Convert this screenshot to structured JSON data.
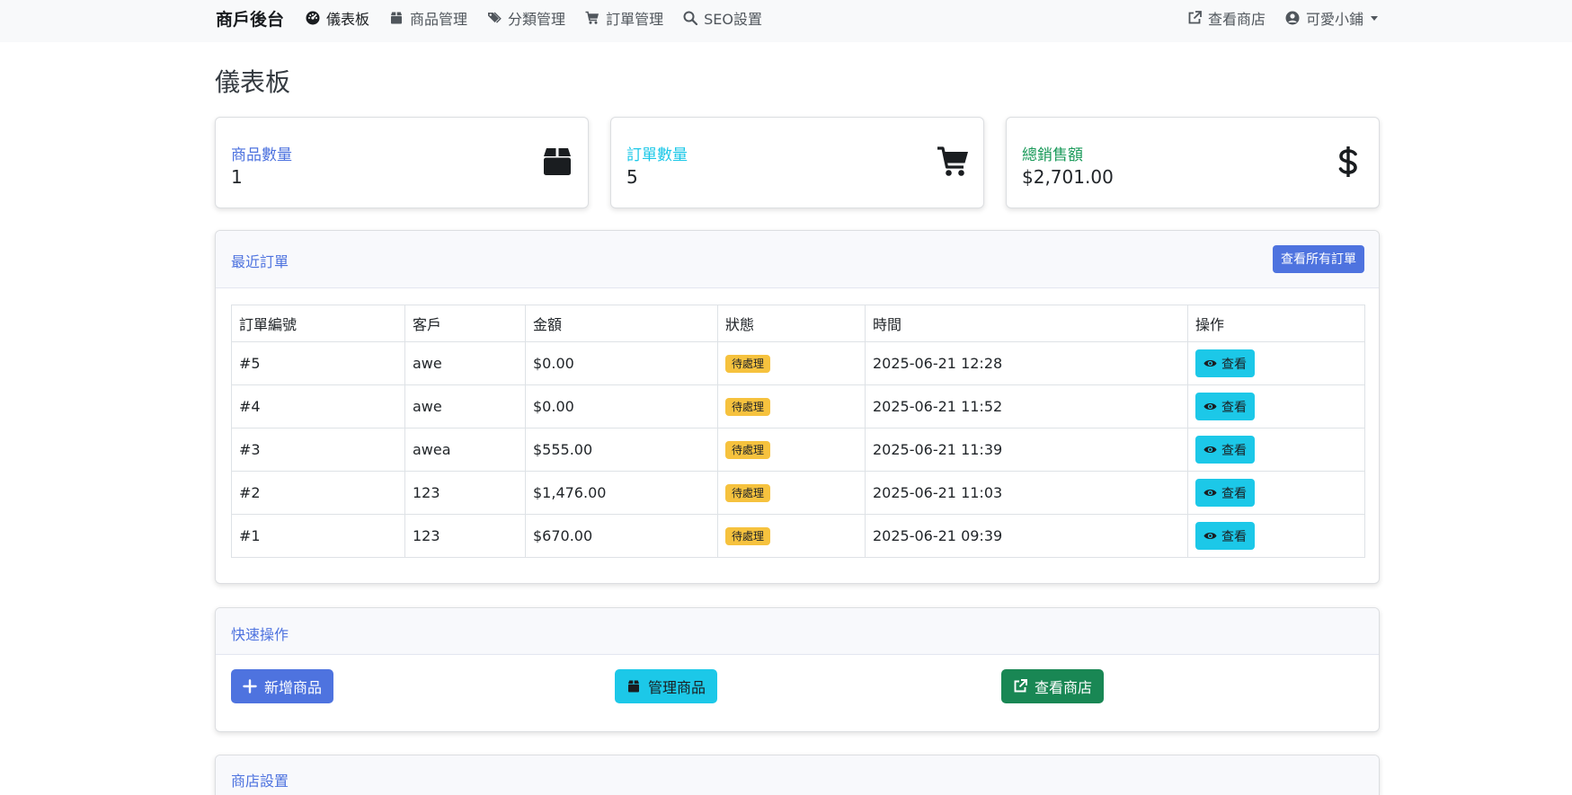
{
  "navbar": {
    "brand": "商戶後台",
    "items": [
      {
        "label": "儀表板",
        "icon": "dashboard-icon",
        "active": true
      },
      {
        "label": "商品管理",
        "icon": "box-icon"
      },
      {
        "label": "分類管理",
        "icon": "tags-icon"
      },
      {
        "label": "訂單管理",
        "icon": "cart-icon"
      },
      {
        "label": "SEO設置",
        "icon": "search-icon"
      }
    ],
    "view_store": "查看商店",
    "user": "可愛小鋪"
  },
  "page": {
    "title": "儀表板"
  },
  "stats": [
    {
      "label": "商品數量",
      "value": "1",
      "icon": "box-icon",
      "color": "#4e73df"
    },
    {
      "label": "訂單數量",
      "value": "5",
      "icon": "cart-icon",
      "color": "#1cc8e8"
    },
    {
      "label": "總銷售額",
      "value": "$2,701.00",
      "icon": "dollar-icon",
      "color": "#1a9a5a"
    }
  ],
  "recent_orders": {
    "title": "最近訂單",
    "view_all": "查看所有訂單",
    "columns": [
      "訂單編號",
      "客戶",
      "金額",
      "狀態",
      "時間",
      "操作"
    ],
    "rows": [
      {
        "id": "#5",
        "customer": "awe",
        "amount": "$0.00",
        "status": "待處理",
        "time": "2025-06-21 12:28",
        "action": "查看"
      },
      {
        "id": "#4",
        "customer": "awe",
        "amount": "$0.00",
        "status": "待處理",
        "time": "2025-06-21 11:52",
        "action": "查看"
      },
      {
        "id": "#3",
        "customer": "awea",
        "amount": "$555.00",
        "status": "待處理",
        "time": "2025-06-21 11:39",
        "action": "查看"
      },
      {
        "id": "#2",
        "customer": "123",
        "amount": "$1,476.00",
        "status": "待處理",
        "time": "2025-06-21 11:03",
        "action": "查看"
      },
      {
        "id": "#1",
        "customer": "123",
        "amount": "$670.00",
        "status": "待處理",
        "time": "2025-06-21 09:39",
        "action": "查看"
      }
    ]
  },
  "quick_actions": {
    "title": "快速操作",
    "add_product": "新增商品",
    "manage_products": "管理商品",
    "view_store": "查看商店"
  },
  "store_settings": {
    "title": "商店設置"
  },
  "colors": {
    "primary": "#4e73df",
    "info": "#1cc8e8",
    "success": "#1a9a5a",
    "success_btn": "#198754",
    "warning": "#f6c23e"
  }
}
